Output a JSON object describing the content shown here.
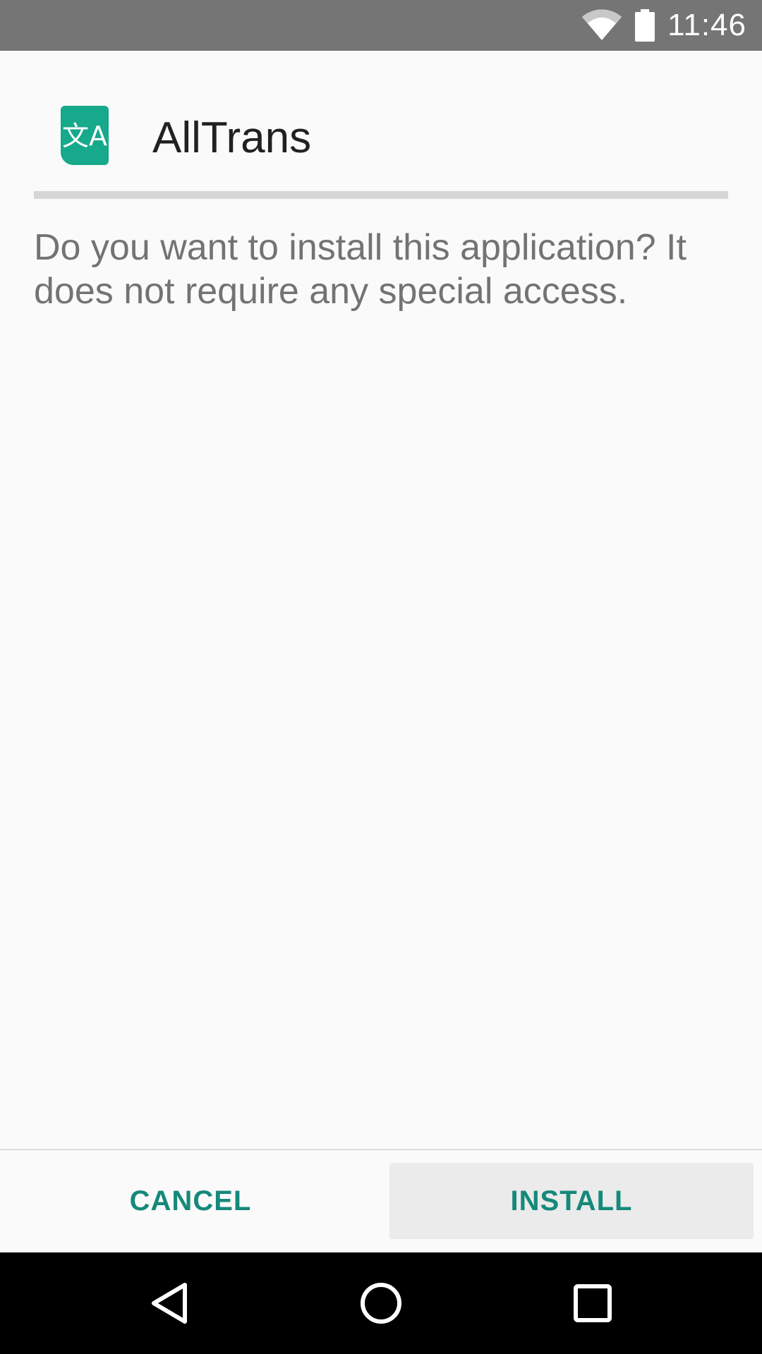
{
  "status_bar": {
    "time": "11:46",
    "icons": [
      "wifi-icon",
      "battery-icon"
    ],
    "background": "#757575"
  },
  "app": {
    "name": "AllTrans",
    "icon": "translate-icon",
    "icon_glyph": "文A",
    "icon_color": "#16a98b"
  },
  "message": "Do you want to install this application? It does not require any special access.",
  "buttons": {
    "cancel": "CANCEL",
    "install": "INSTALL",
    "accent": "#15897a"
  },
  "nav_bar": {
    "items": [
      "back-icon",
      "home-icon",
      "recents-icon"
    ]
  }
}
